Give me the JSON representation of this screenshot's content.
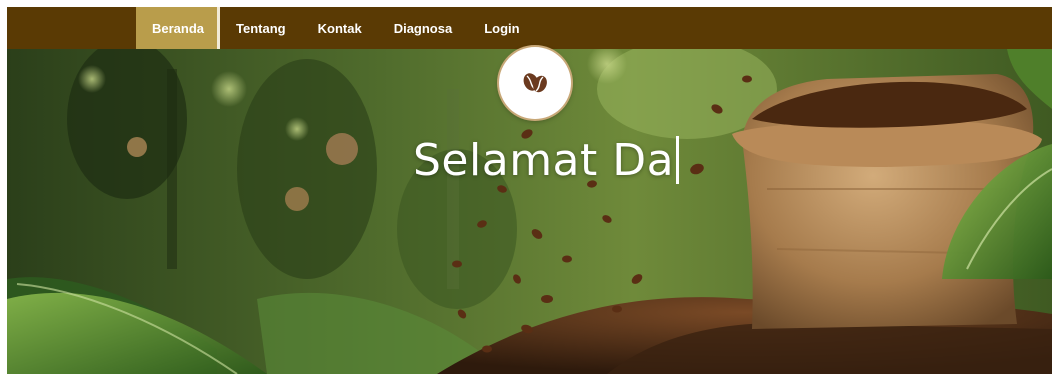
{
  "nav": {
    "items": [
      {
        "label": "Beranda",
        "active": true
      },
      {
        "label": "Tentang",
        "active": false
      },
      {
        "label": "Kontak",
        "active": false
      },
      {
        "label": "Diagnosa",
        "active": false
      },
      {
        "label": "Login",
        "active": false
      }
    ]
  },
  "hero": {
    "title_typed": "Selamat Da",
    "logo_icon": "coffee-bean-icon",
    "background_image": "coffee-sack-with-beans-in-forest"
  },
  "colors": {
    "navbar": "#5a3a04",
    "nav_active": "#b99d4b",
    "nav_text": "#ffffff"
  }
}
